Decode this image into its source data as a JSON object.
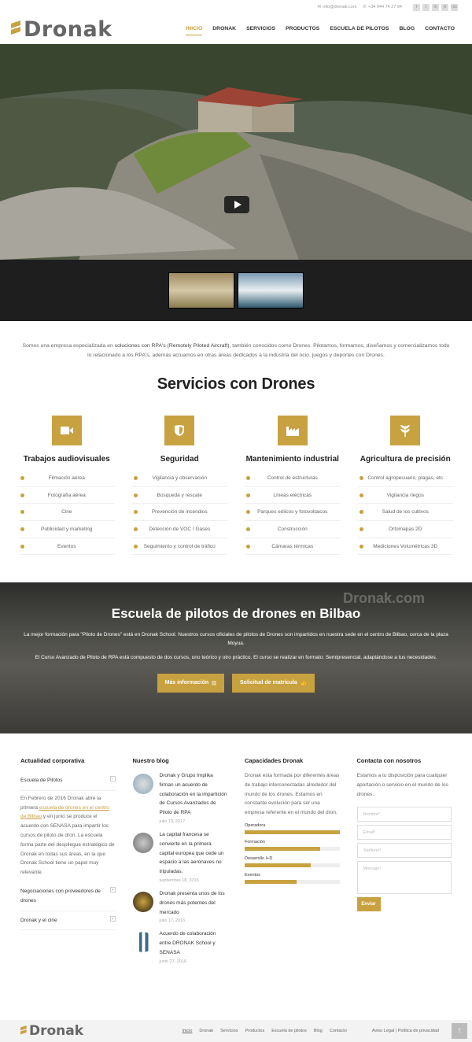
{
  "topbar": {
    "email": "info@dronak.com",
    "phone": "+34 944 74 27 94",
    "social": [
      "f",
      "t",
      "in",
      "yt",
      "rss"
    ]
  },
  "header": {
    "logo": "Dronak"
  },
  "nav": [
    "INICIO",
    "DRONAK",
    "SERVICIOS",
    "PRODUCTOS",
    "ESCUELA DE PILOTOS",
    "BLOG",
    "CONTACTO"
  ],
  "intro": {
    "text_a": "Somos una empresa especializada en ",
    "text_b": "soluciones con RPA's (Remotely Piloted Aircraft)",
    "text_c": ", también conocidos como Drones. Pilotamos, formamos, diseñamos y comercializamos todo lo relacionado a los RPA's, además actuamos en otras áreas dedicados a la industria del ocio, juegos y deportes con Drones."
  },
  "services": {
    "title": "Servicios con Drones",
    "columns": [
      {
        "title": "Trabajos audiovisuales",
        "icon": "video-camera-icon",
        "items": [
          "Filmación aérea",
          "Fotografía aérea",
          "Cine",
          "Publicidad y marketing",
          "Eventos"
        ]
      },
      {
        "title": "Seguridad",
        "icon": "shield-icon",
        "items": [
          "Vigilancia y observación",
          "Búsqueda y rescate",
          "Prevención de incendios",
          "Detección de VOC / Gases",
          "Seguimiento y control de tráfico"
        ]
      },
      {
        "title": "Mantenimiento industrial",
        "icon": "factory-icon",
        "items": [
          "Control de estructuras",
          "Líneas eléctricas",
          "Parques eólicos y fotovoltaicos",
          "Construcción",
          "Cámaras térmicas"
        ]
      },
      {
        "title": "Agricultura de precisión",
        "icon": "leaf-icon",
        "items": [
          "Control agropecuario, plagas, etc",
          "Vigilancia riegos",
          "Salud de los cultivos",
          "Ortomapas 2D",
          "Mediciones Volumétricas 3D"
        ]
      }
    ]
  },
  "school": {
    "watermark": "Dronak.com",
    "title": "Escuela de pilotos de drones en Bilbao",
    "p1": "La mejor formación para \"Piloto de Drones\" está en Dronak School. Nuestros cursos oficiales de pilotos de Drones son impartidos en nuestra sede en el centro de Bilbao, cerca de la plaza Moyua.",
    "p2": "El Curso Avanzado de Piloto de RPA está compuesto de dos cursos, uno teórico y otro práctico. El curso se realizar en formato: Semipresencial, adaptándose a tus necesidades.",
    "btn_info": "Más información",
    "btn_enroll": "Solicitud de matrícula"
  },
  "news": {
    "title": "Actualidad corporativa",
    "items": [
      {
        "label": "Escuela de Pilotos",
        "open": true
      },
      {
        "label": "Negociaciones con proveedores de drones"
      },
      {
        "label": "Dronak y el cine"
      }
    ],
    "body_a": "En Febrero de 2016 Dronak abre la primera ",
    "body_link": "escuela de drones en el centro de Bilbao",
    "body_b": " y en junio se produce el acuerdo con SENASA para impartir los cursos de piloto de dron. La escuela forma parte del despliegue estratégico de Dronak en todas sus áreas, en la que Dronak School tiene un papel muy relevante."
  },
  "blog": {
    "title": "Nuestro blog",
    "posts": [
      {
        "title": "Dronak y Grupo Implika firman un acuerdo de colaboración en la impartición de Cursos Avanzados de Piloto de RPA",
        "date": "julio 19, 2017"
      },
      {
        "title": "La capital francesa se convierte en la primera capital europea que cede un espacio a las aeronaves no tripuladas.",
        "date": "septiembre 18, 2016"
      },
      {
        "title": "Dronak presenta unos de los drones más potentes del mercado",
        "date": "julio 17, 2016"
      },
      {
        "title": "Acuerdo de colaboración entre DRONAK School y SENASA",
        "date": "junio 27, 2016"
      }
    ]
  },
  "capabilities": {
    "title": "Capacidades Dronak",
    "text": "Dronak esta formada por diferentes áreas de trabajo interconectadas alrededor del mundo de los drones. Estamos en constante evolución para ser una empresa referente en el mundo del dron.",
    "bars": [
      {
        "label": "Operadora",
        "level": 1.0
      },
      {
        "label": "Formación",
        "level": 0.8
      },
      {
        "label": "Desarrollo I+D",
        "level": 0.7
      },
      {
        "label": "Eventos",
        "level": 0.55
      }
    ]
  },
  "contact": {
    "title": "Contacta con nosotros",
    "text": "Estamos a tu disposición para cualquier aportación o servicio en el mundo de los drones.",
    "name_ph": "Nombre*",
    "email_ph": "Email*",
    "phone_ph": "Teléfono*",
    "msg_ph": "Mensaje*",
    "send": "Enviar"
  },
  "footer": {
    "logo": "Dronak",
    "nav": [
      "Inicio",
      "Dronak",
      "Servicios",
      "Productos",
      "Escuela de pilotos",
      "Blog",
      "Contacto"
    ],
    "legal": "Aviso Legal | Política de privacidad"
  },
  "colors": {
    "accent": "#c8a140"
  }
}
